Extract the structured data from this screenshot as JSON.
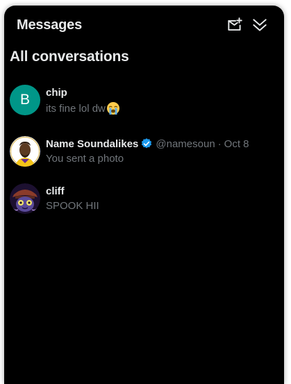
{
  "header": {
    "title": "Messages",
    "new_message_icon": "new-message-icon",
    "collapse_icon": "double-chevron-down-icon"
  },
  "section_title": "All conversations",
  "conversations": [
    {
      "avatar_letter": "B",
      "avatar_color": "#009688",
      "name": "chip",
      "preview": "its fine lol dw",
      "preview_emoji": "loudly-crying-face"
    },
    {
      "avatar_icon": "profile-photo",
      "name": "Name Soundalikes",
      "verified": true,
      "handle": "@namesoun",
      "separator": "·",
      "date": "Oct 8",
      "preview": "You sent a photo"
    },
    {
      "avatar_icon": "profile-photo-cartoon",
      "name": "cliff",
      "preview": "SPOOK HII"
    }
  ],
  "colors": {
    "background": "#000000",
    "text_primary": "#e7e9ea",
    "text_secondary": "#71767b",
    "verified_blue": "#1d9bf0"
  }
}
